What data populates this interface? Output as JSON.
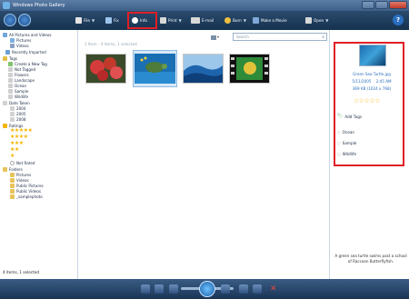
{
  "window": {
    "title": "Windows Photo Gallery"
  },
  "toolbar": {
    "items": [
      {
        "label": "File",
        "icon": "file-icon",
        "color": "#e5e5e5"
      },
      {
        "label": "Fix",
        "icon": "fix-icon",
        "color": "#9ec5ec"
      },
      {
        "label": "Info",
        "icon": "info-icon",
        "color": "#ffffff"
      },
      {
        "label": "Print",
        "icon": "print-icon",
        "color": "#d8d8d8"
      },
      {
        "label": "E-mail",
        "icon": "email-icon",
        "color": "#d8d8d8"
      },
      {
        "label": "Burn",
        "icon": "burn-icon",
        "color": "#f0c040"
      },
      {
        "label": "Make a Movie",
        "icon": "movie-icon",
        "color": "#7fa8d6"
      },
      {
        "label": "Open",
        "icon": "open-icon",
        "color": "#d8d8d8"
      }
    ],
    "help": "?"
  },
  "nav": {
    "all": "All Pictures and Videos",
    "pictures": "Pictures",
    "videos": "Videos",
    "recent": "Recently Imported",
    "tags_header": "Tags",
    "tags": [
      "Create a New Tag",
      "Not Tagged",
      "Flowers",
      "Landscape",
      "Ocean",
      "Sample",
      "Wildlife"
    ],
    "date_header": "Date Taken",
    "years": [
      "2004",
      "2005",
      "2008"
    ],
    "ratings_header": "Ratings",
    "ratings": [
      "★★★★★",
      "★★★★",
      "★★★",
      "★★",
      "★"
    ],
    "not_rated": "Not Rated",
    "folders_header": "Folders",
    "folders": [
      "Pictures",
      "Videos",
      "Public Pictures",
      "Public Videos",
      "_samplephoto"
    ]
  },
  "main": {
    "status": "1 Item - 4 items, 1 selected",
    "search_placeholder": "Search",
    "thumbnails": [
      {
        "name": "flowers",
        "color": "#c0392b"
      },
      {
        "name": "green-sea-turtle",
        "color": "#1f7bc0",
        "selected": true
      },
      {
        "name": "ocean-wave",
        "color": "#2a74b8"
      },
      {
        "name": "video",
        "color": "#2e8b3a"
      }
    ]
  },
  "info": {
    "filename": "Green Sea Turtle.jpg",
    "date": "5/11/2005",
    "time": "2:45 AM",
    "size": "369 KB (1024 x 768)",
    "rating_stars": "☆☆☆☆☆",
    "add_tags": "Add Tags",
    "tags": [
      "Ocean",
      "Sample",
      "Wildlife"
    ],
    "description": "A green sea turtle swims past a school of Raccoon Butterflyfish."
  },
  "status": {
    "text": "4 items, 1 selected"
  }
}
